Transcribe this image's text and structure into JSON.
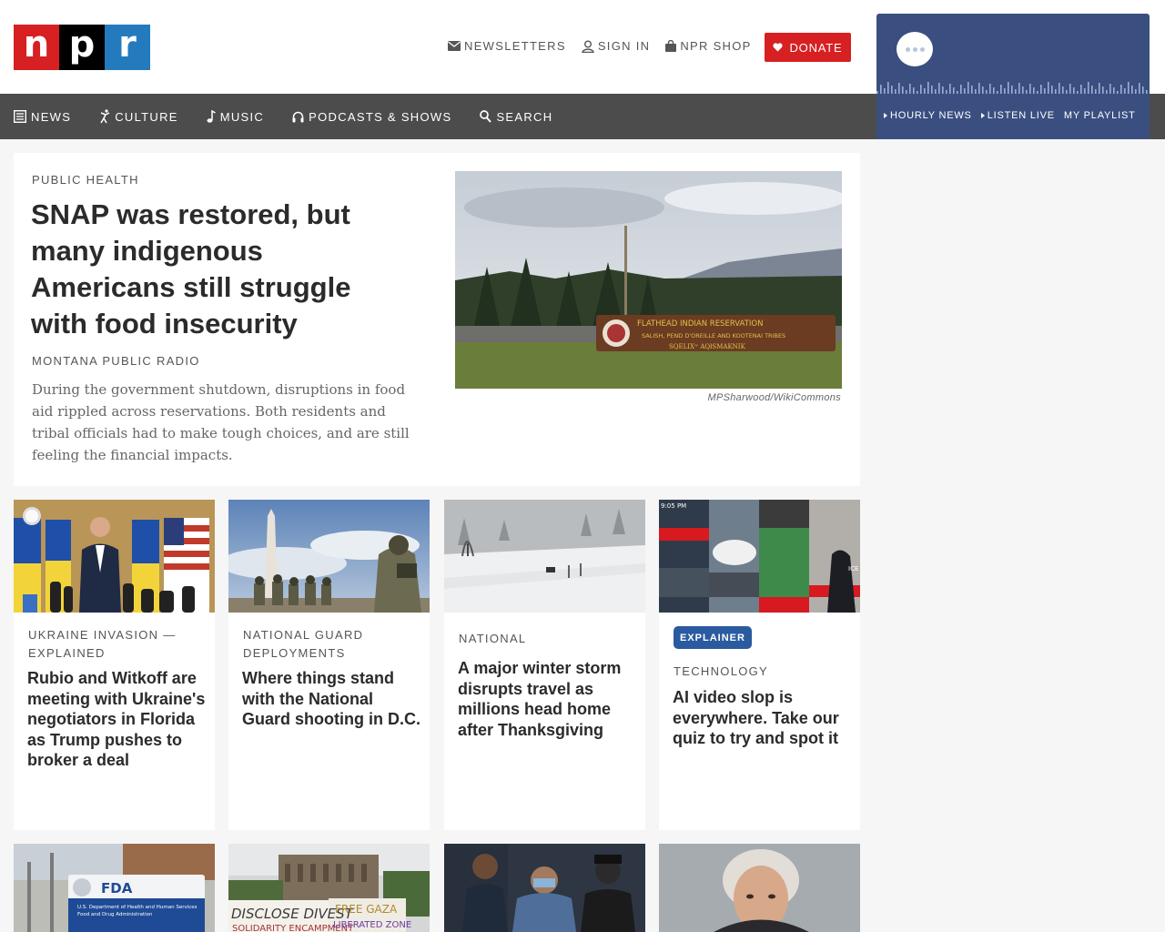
{
  "header": {
    "logo": {
      "n": "n",
      "p": "p",
      "r": "r"
    },
    "utilities": [
      {
        "label": "NEWSLETTERS",
        "icon": "envelope-icon"
      },
      {
        "label": "SIGN IN",
        "icon": "user-icon"
      },
      {
        "label": "NPR SHOP",
        "icon": "shopping-bag-icon"
      }
    ],
    "donate_label": "DONATE"
  },
  "nav": {
    "items": [
      {
        "label": "NEWS",
        "icon": "newspaper-icon"
      },
      {
        "label": "CULTURE",
        "icon": "dancer-icon"
      },
      {
        "label": "MUSIC",
        "icon": "music-note-icon"
      },
      {
        "label": "PODCASTS & SHOWS",
        "icon": "headphones-icon"
      },
      {
        "label": "SEARCH",
        "icon": "search-icon"
      }
    ]
  },
  "player": {
    "links": [
      {
        "label": "HOURLY NEWS"
      },
      {
        "label": "LISTEN LIVE"
      },
      {
        "label": "MY PLAYLIST"
      }
    ],
    "colors": {
      "background": "#3a4f80"
    }
  },
  "featured": {
    "slug": "PUBLIC HEALTH",
    "title": "SNAP was restored, but many indigenous Americans still struggle with food insecurity",
    "source": "MONTANA PUBLIC RADIO",
    "teaser": "During the government shutdown, disruptions in food aid rippled across reservations. Both residents and tribal officials had to make tough choices, and are still feeling the financial impacts.",
    "image_credit": "MPSharwood/WikiCommons",
    "image_sign": {
      "line1": "FLATHEAD INDIAN RESERVATION",
      "line2": "SALISH, PEND D'OREILLE AND KOOTENAI TRIBES",
      "line3": "SQELIXʷ AQłSMAKNIK"
    }
  },
  "cards": [
    {
      "slug": "UKRAINE INVASION — EXPLAINED",
      "title": "Rubio and Witkoff are meeting with Ukraine's negotiators in Florida as Trump pushes to broker a deal"
    },
    {
      "slug": "NATIONAL GUARD DEPLOYMENTS",
      "title": "Where things stand with the National Guard shooting in D.C."
    },
    {
      "slug": "NATIONAL",
      "title": "A major winter storm disrupts travel as millions head home after Thanksgiving"
    },
    {
      "badge": "EXPLAINER",
      "slug": "TECHNOLOGY",
      "title": "AI video slop is everywhere. Take our quiz to try and spot it",
      "thumb_time": "9:05 PM",
      "thumb_tag": "ICE"
    }
  ],
  "row2": {
    "fda_sign": {
      "brand": "FDA",
      "line1": "U.S. Department of Health and Human Services",
      "line2": "Food and Drug Administration"
    },
    "protest_signs": {
      "left": "DISCLOSE DIVEST",
      "left_sub": "SOLIDARITY ENCAMPMENT",
      "right": "FREE GAZA",
      "right_sub": "LIBERATED ZONE"
    }
  },
  "colors": {
    "npr_red": "#d62021",
    "npr_black": "#000000",
    "npr_blue": "#237bbd",
    "nav_bg": "#4c4c4c",
    "badge": "#2a5aa0"
  }
}
